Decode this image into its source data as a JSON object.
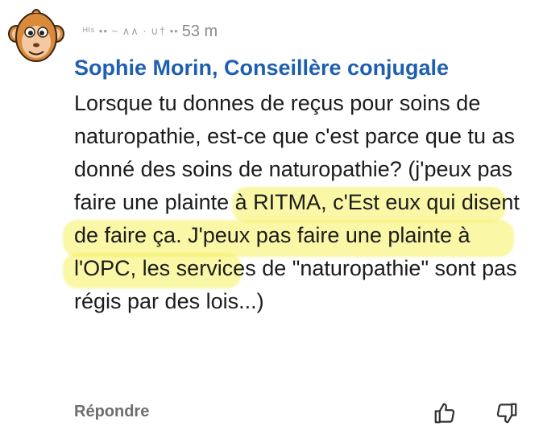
{
  "comment": {
    "meta": {
      "name_scribble": "ᴴᴵˢ •• ~ ∧∧ · ∪† ••",
      "time": "53 m"
    },
    "author": "Sophie Morin, Conseillère conjugale",
    "text": "Lorsque tu donnes de reçus pour soins de naturopathie, est-ce que c'est parce que tu as donné des soins de naturopathie? (j'peux pas faire une plainte à RITMA, c'Est eux qui disent de faire ça. J'peux pas faire une plainte à l'OPC, les services de \"naturopathie\" sont pas régis par des lois...)",
    "reply_label": "Répondre"
  },
  "icons": {
    "avatar": "monkey-avatar-icon",
    "like": "thumbs-up-icon",
    "dislike": "thumbs-down-icon"
  },
  "colors": {
    "author": "#1f5fb0",
    "highlight": "#f5f05f",
    "meta": "#8a8a8a"
  }
}
